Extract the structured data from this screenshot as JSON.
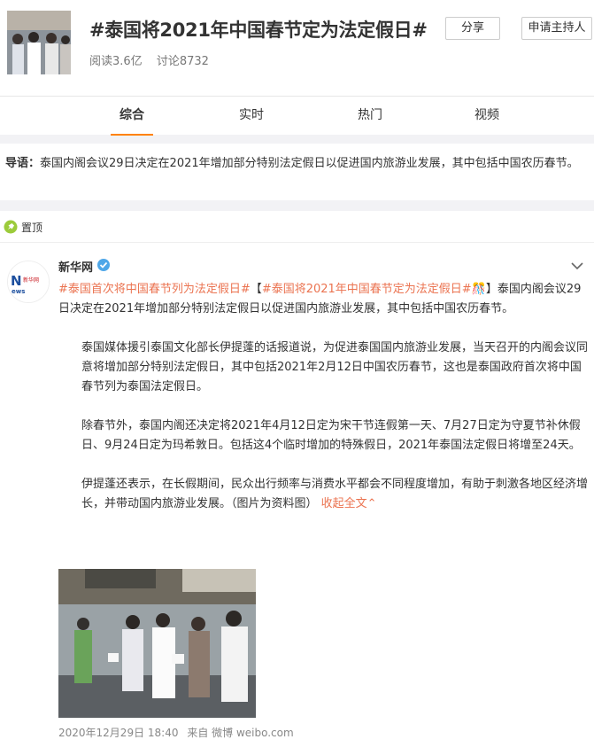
{
  "header": {
    "title": "#泰国将2021年中国春节定为法定假日#",
    "reads": "阅读3.6亿",
    "discussions": "讨论8732",
    "share_label": "分享",
    "host_label": "申请主持人"
  },
  "tabs": [
    {
      "label": "综合",
      "active": true
    },
    {
      "label": "实时",
      "active": false
    },
    {
      "label": "热门",
      "active": false
    },
    {
      "label": "视频",
      "active": false
    }
  ],
  "guide": {
    "prefix": "导语：",
    "text": "泰国内阁会议29日决定在2021年增加部分特别法定假日以促进国内旅游业发展，其中包括中国农历春节。"
  },
  "pinned": {
    "label": "置顶"
  },
  "post": {
    "author": "新华网",
    "avatar_text": "新华网",
    "tag1": "#泰国首次将中国春节列为法定假日#",
    "bracket_open": "【",
    "tag2": "#泰国将2021年中国春节定为法定假日#",
    "bracket_close": "】",
    "p1_rest": "泰国内阁会议29日决定在2021年增加部分特别法定假日以促进国内旅游业发展，其中包括中国农历春节。",
    "p2": "泰国媒体援引泰国文化部长伊提蓬的话报道说，为促进泰国国内旅游业发展，当天召开的内阁会议同意将增加部分特别法定假日，其中包括2021年2月12日中国农历春节，这也是泰国政府首次将中国春节列为泰国法定假日。",
    "p3": "除春节外，泰国内阁还决定将2021年4月12日定为宋干节连假第一天、7月27日定为守夏节补休假日、9月24日定为玛希敦日。包括这4个临时增加的特殊假日，2021年泰国法定假日将增至24天。",
    "p4": "伊提蓬还表示，在长假期间，民众出行频率与消费水平都会不同程度增加，有助于刺激各地区经济增长，并带动国内旅游业发展。（图片为资料图）",
    "collapse_label": "收起全文",
    "time": "2020年12月29日 18:40",
    "source": "来自 微博 weibo.com"
  },
  "colors": {
    "accent": "#ff8200",
    "link": "#eb7350",
    "verified": "#4fa7e8"
  }
}
